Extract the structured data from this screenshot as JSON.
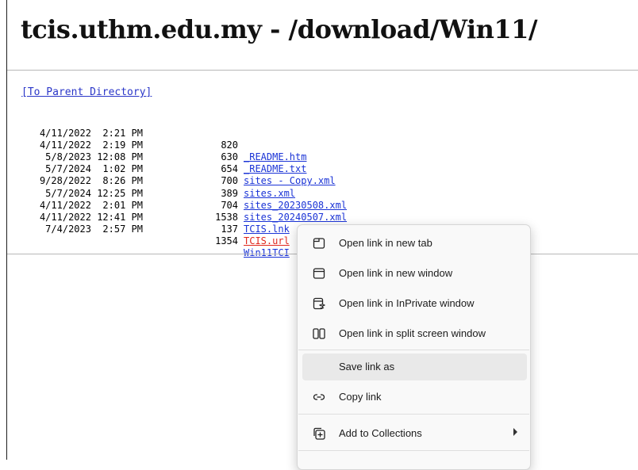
{
  "page": {
    "title": "tcis.uthm.edu.my - /download/Win11/",
    "parent_link": "[To Parent Directory]"
  },
  "files": [
    {
      "date": "4/11/2022  2:21 PM",
      "size": "820",
      "name": "_README.htm",
      "visited": false
    },
    {
      "date": "4/11/2022  2:19 PM",
      "size": "630",
      "name": "_README.txt",
      "visited": false
    },
    {
      "date": "5/8/2023 12:08 PM",
      "size": "654",
      "name": "sites - Copy.xml",
      "visited": false
    },
    {
      "date": "5/7/2024  1:02 PM",
      "size": "700",
      "name": "sites.xml",
      "visited": false
    },
    {
      "date": "9/28/2022  8:26 PM",
      "size": "389",
      "name": "sites_20230508.xml",
      "visited": false
    },
    {
      "date": "5/7/2024 12:25 PM",
      "size": "704",
      "name": "sites_20240507.xml",
      "visited": false
    },
    {
      "date": "4/11/2022  2:01 PM",
      "size": "1538",
      "name": "TCIS.lnk",
      "visited": false
    },
    {
      "date": "4/11/2022 12:41 PM",
      "size": "137",
      "name": "TCIS.url",
      "visited": true
    },
    {
      "date": "7/4/2023  2:57 PM",
      "size": "1354",
      "name": "Win11TCI",
      "visited": false
    }
  ],
  "context_menu": {
    "items": [
      {
        "label": "Open link in new tab",
        "icon": "new-tab-icon"
      },
      {
        "label": "Open link in new window",
        "icon": "new-window-icon"
      },
      {
        "label": "Open link in InPrivate window",
        "icon": "inprivate-window-icon"
      },
      {
        "label": "Open link in split screen window",
        "icon": "split-screen-icon"
      },
      {
        "label": "Save link as",
        "icon": ""
      },
      {
        "label": "Copy link",
        "icon": "link-icon"
      },
      {
        "label": "Add to Collections",
        "icon": "collections-icon"
      }
    ],
    "highlighted_item": "Save link as"
  },
  "colors": {
    "link": "#1a33d6",
    "visited_link": "#e0281e",
    "menu_bg": "#f9f9f9",
    "menu_highlight": "#e9e9e9"
  }
}
